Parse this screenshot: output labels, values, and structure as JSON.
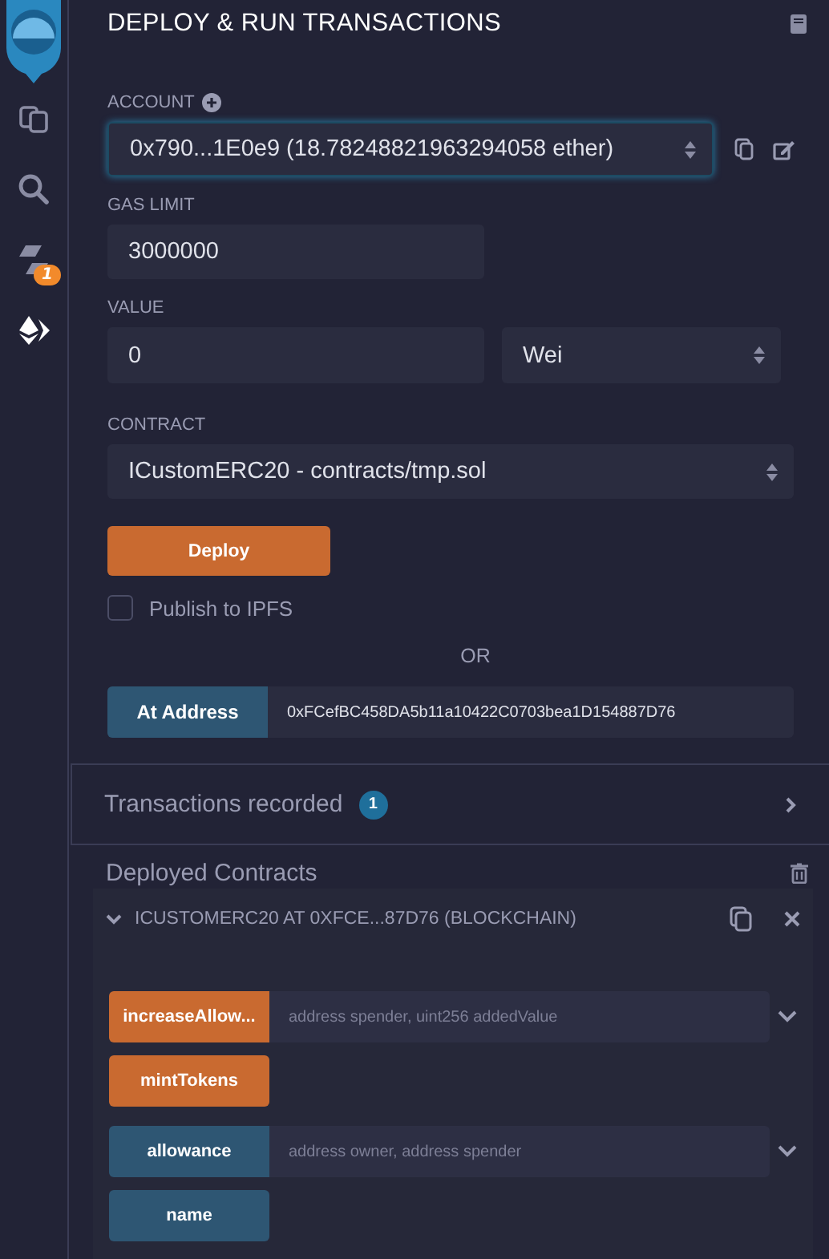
{
  "sidebar": {
    "items": [
      {
        "kind": "files",
        "selected": false
      },
      {
        "kind": "search",
        "selected": false
      },
      {
        "kind": "compiler",
        "selected": false,
        "badge": "1"
      },
      {
        "kind": "deploy",
        "selected": true
      }
    ]
  },
  "panel": {
    "title": "DEPLOY & RUN TRANSACTIONS",
    "account": {
      "label": "ACCOUNT",
      "value": "0x790...1E0e9 (18.78248821963294058 ether)",
      "focused": true
    },
    "gas_limit": {
      "label": "GAS LIMIT",
      "value": "3000000"
    },
    "value": {
      "label": "VALUE",
      "value": "0",
      "unit": "Wei"
    },
    "contract": {
      "label": "CONTRACT",
      "value": "ICustomERC20 - contracts/tmp.sol"
    },
    "deploy_button": "Deploy",
    "publish": {
      "label": "Publish to IPFS",
      "checked": false
    },
    "or_text": "OR",
    "at_address": {
      "button": "At Address",
      "value": "0xFCefBC458DA5b11a10422C0703bea1D154887D76"
    },
    "transactions_recorded": {
      "label": "Transactions recorded",
      "count": "1",
      "expanded": false
    },
    "deployed_contracts": {
      "title": "Deployed Contracts",
      "instances": [
        {
          "title": "ICUSTOMERC20 AT 0XFCE...87D76 (BLOCKCHAIN)",
          "expanded": true,
          "functions": [
            {
              "label": "increaseAllow...",
              "kind": "transact",
              "placeholder": "address spender, uint256 addedValue"
            },
            {
              "label": "mintTokens",
              "kind": "transact"
            },
            {
              "label": "allowance",
              "kind": "call",
              "placeholder": "address owner, address spender"
            },
            {
              "label": "name",
              "kind": "call"
            }
          ]
        }
      ]
    }
  }
}
